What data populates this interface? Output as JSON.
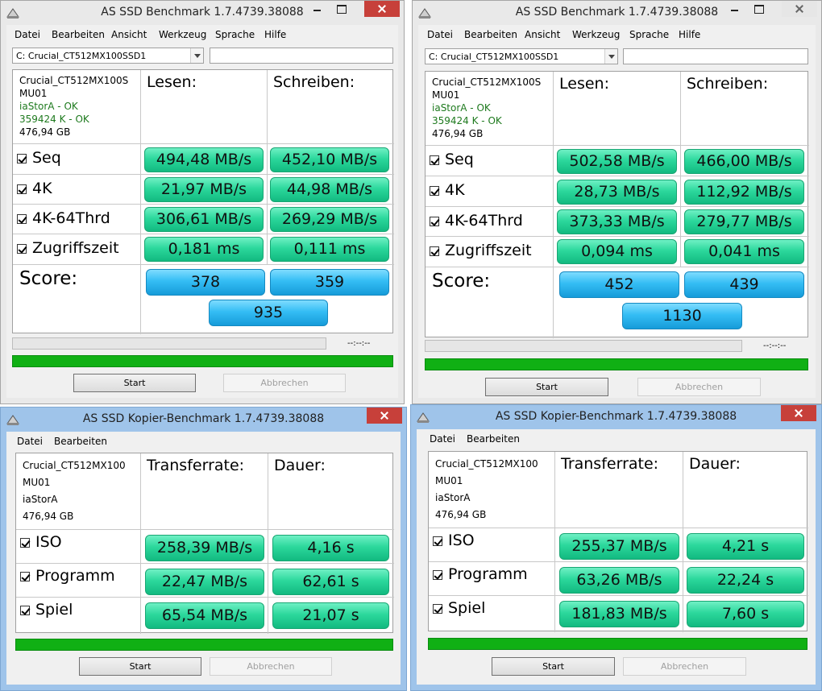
{
  "benchmark_windows": [
    {
      "title": "AS SSD Benchmark 1.7.4739.38088",
      "menu": [
        "Datei",
        "Bearbeiten",
        "Ansicht",
        "Werkzeug",
        "Sprache",
        "Hilfe"
      ],
      "drive_select": "C: Crucial_CT512MX100SSD1",
      "drive_info": [
        "Crucial_CT512MX100S",
        "MU01",
        "iaStorA - OK",
        "359424 K - OK",
        "476,94 GB"
      ],
      "col_read": "Lesen:",
      "col_write": "Schreiben:",
      "rows": [
        {
          "label": "Seq",
          "read": "494,48 MB/s",
          "write": "452,10 MB/s"
        },
        {
          "label": "4K",
          "read": "21,97 MB/s",
          "write": "44,98 MB/s"
        },
        {
          "label": "4K-64Thrd",
          "read": "306,61 MB/s",
          "write": "269,29 MB/s"
        },
        {
          "label": "Zugriffszeit",
          "read": "0,181 ms",
          "write": "0,111 ms"
        }
      ],
      "score_label": "Score:",
      "score_read": "378",
      "score_write": "359",
      "score_total": "935",
      "time": "--:--:--",
      "progress": 1.0,
      "start": "Start",
      "cancel": "Abbrechen"
    },
    {
      "title": "AS SSD Benchmark 1.7.4739.38088",
      "menu": [
        "Datei",
        "Bearbeiten",
        "Ansicht",
        "Werkzeug",
        "Sprache",
        "Hilfe"
      ],
      "drive_select": "C: Crucial_CT512MX100SSD1",
      "drive_info": [
        "Crucial_CT512MX100S",
        "MU01",
        "iaStorA - OK",
        "359424 K - OK",
        "476,94 GB"
      ],
      "col_read": "Lesen:",
      "col_write": "Schreiben:",
      "rows": [
        {
          "label": "Seq",
          "read": "502,58 MB/s",
          "write": "466,00 MB/s"
        },
        {
          "label": "4K",
          "read": "28,73 MB/s",
          "write": "112,92 MB/s"
        },
        {
          "label": "4K-64Thrd",
          "read": "373,33 MB/s",
          "write": "279,77 MB/s"
        },
        {
          "label": "Zugriffszeit",
          "read": "0,094 ms",
          "write": "0,041 ms"
        }
      ],
      "score_label": "Score:",
      "score_read": "452",
      "score_write": "439",
      "score_total": "1130",
      "time": "--:--:--",
      "progress": 1.0,
      "start": "Start",
      "cancel": "Abbrechen"
    }
  ],
  "copy_windows": [
    {
      "title": "AS SSD Kopier-Benchmark 1.7.4739.38088",
      "menu": [
        "Datei",
        "Bearbeiten"
      ],
      "drive_info": [
        "Crucial_CT512MX100",
        "MU01",
        "iaStorA",
        "476,94 GB"
      ],
      "col_rate": "Transferrate:",
      "col_duration": "Dauer:",
      "rows": [
        {
          "label": "ISO",
          "rate": "258,39 MB/s",
          "duration": "4,16 s"
        },
        {
          "label": "Programm",
          "rate": "22,47 MB/s",
          "duration": "62,61 s"
        },
        {
          "label": "Spiel",
          "rate": "65,54 MB/s",
          "duration": "21,07 s"
        }
      ],
      "progress": 1.0,
      "start": "Start",
      "cancel": "Abbrechen"
    },
    {
      "title": "AS SSD Kopier-Benchmark 1.7.4739.38088",
      "menu": [
        "Datei",
        "Bearbeiten"
      ],
      "drive_info": [
        "Crucial_CT512MX100",
        "MU01",
        "iaStorA",
        "476,94 GB"
      ],
      "col_rate": "Transferrate:",
      "col_duration": "Dauer:",
      "rows": [
        {
          "label": "ISO",
          "rate": "255,37 MB/s",
          "duration": "4,21 s"
        },
        {
          "label": "Programm",
          "rate": "63,26 MB/s",
          "duration": "22,24 s"
        },
        {
          "label": "Spiel",
          "rate": "181,83 MB/s",
          "duration": "7,60 s"
        }
      ],
      "progress": 1.0,
      "start": "Start",
      "cancel": "Abbrechen"
    }
  ],
  "icons": {
    "app": "ssd-benchmark-icon",
    "minimize": "minimize-icon",
    "maximize": "maximize-icon",
    "close": "close-icon",
    "checkbox": "checkbox-checked-icon",
    "dropdown": "chevron-down-icon"
  },
  "colors": {
    "result_green": "#2cd89c",
    "score_blue": "#34bdf4",
    "progress_green": "#10b014",
    "close_red": "#c7403a",
    "status_ok": "#1e7a1e"
  }
}
